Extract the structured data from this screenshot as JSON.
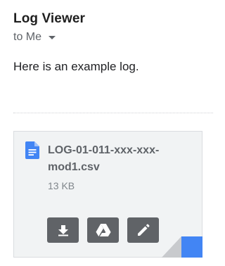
{
  "email": {
    "subject": "Log Viewer",
    "recipient": "to Me",
    "body": "Here is an example log."
  },
  "attachment": {
    "filename": "LOG-01-011-xxx-xxx-mod1.csv",
    "size": "13 KB",
    "icon": "document-icon",
    "actions": [
      {
        "name": "download",
        "icon": "download-icon"
      },
      {
        "name": "save-to-drive",
        "icon": "drive-icon"
      },
      {
        "name": "edit",
        "icon": "pencil-icon"
      }
    ]
  },
  "colors": {
    "file_icon": "#4285f4",
    "action_button": "#606367",
    "fold_corner": "#4285f4"
  }
}
